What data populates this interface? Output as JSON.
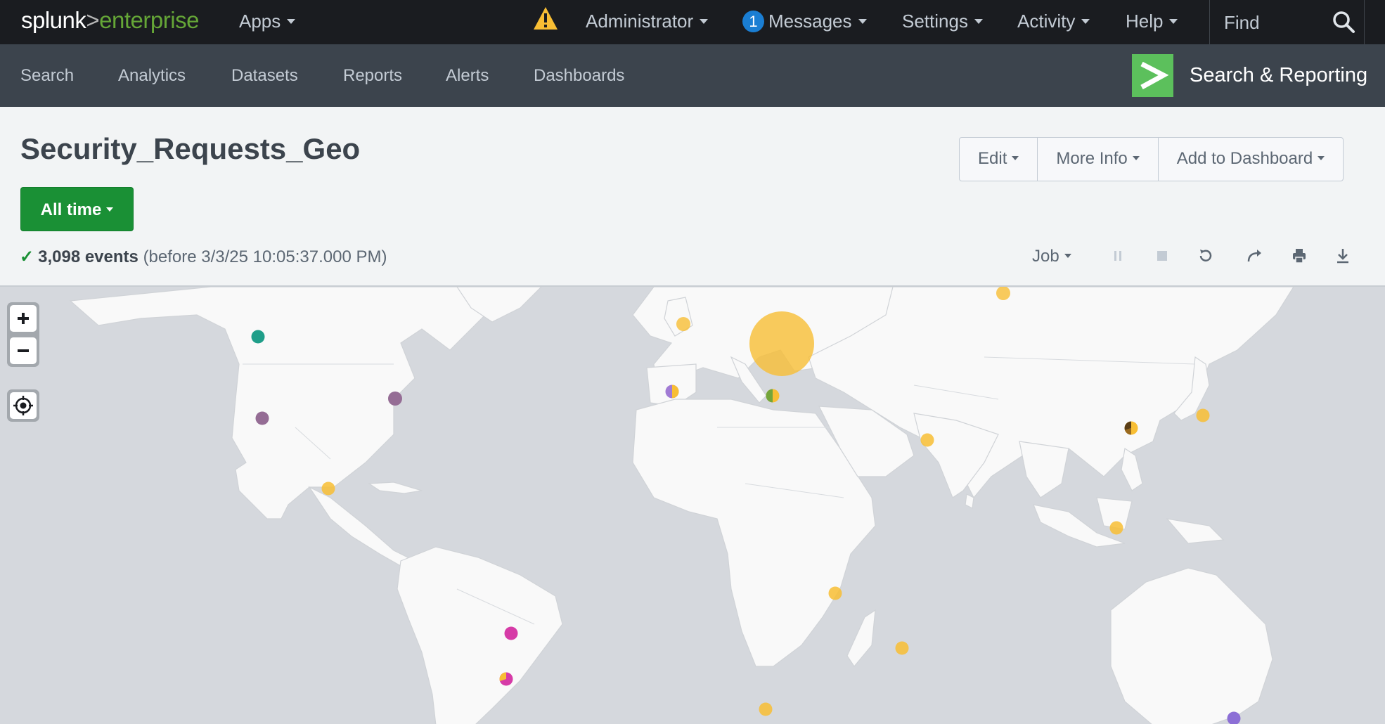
{
  "topbar": {
    "logo": {
      "part1": "splunk",
      "part2": ">",
      "part3": "enterprise"
    },
    "apps": "Apps",
    "user": "Administrator",
    "messages_count": "1",
    "messages": "Messages",
    "settings": "Settings",
    "activity": "Activity",
    "help": "Help",
    "find_placeholder": "Find"
  },
  "appbar": {
    "nav": [
      "Search",
      "Analytics",
      "Datasets",
      "Reports",
      "Alerts",
      "Dashboards"
    ],
    "app_title": "Search & Reporting"
  },
  "header": {
    "title": "Security_Requests_Geo",
    "buttons": {
      "edit": "Edit",
      "more_info": "More Info",
      "add_dashboard": "Add to Dashboard"
    },
    "time_range": "All time"
  },
  "status": {
    "check": "✓",
    "event_count": "3,098 events",
    "detail": "(before 3/3/25 10:05:37.000 PM)",
    "job": "Job"
  },
  "colors": {
    "topbar_bg": "#1a1c20",
    "appbar_bg": "#3c444d",
    "time_btn": "#1a9035",
    "app_icon": "#5cc05c",
    "warning": "#f8be34",
    "badge": "#1a7ed3",
    "marker_orange": "#f8be34",
    "marker_purple": "#956d95",
    "marker_teal": "#31a35f",
    "marker_pink": "#d63ba7"
  }
}
